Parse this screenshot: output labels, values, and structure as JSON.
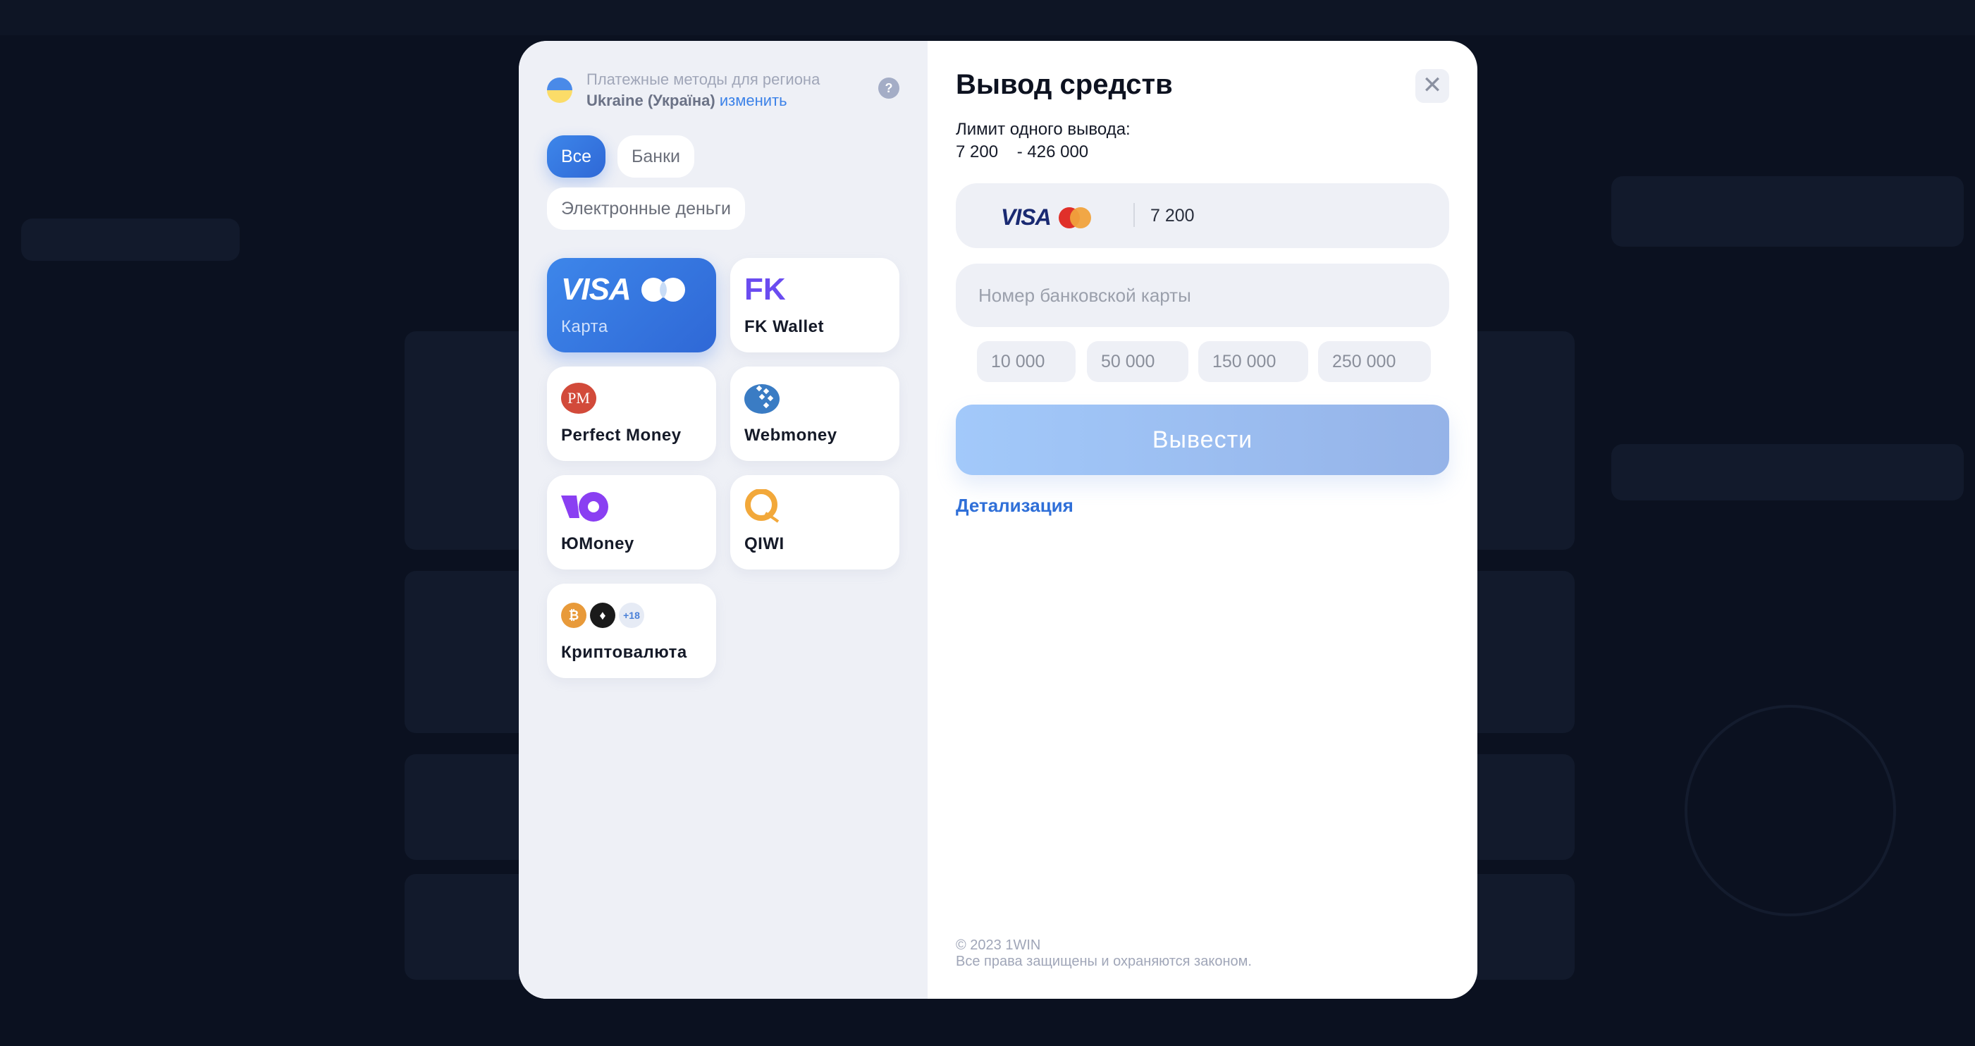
{
  "colors": {
    "accent": "#3578e5",
    "overlay": "#0b1120",
    "panel": "#eef0f6",
    "link": "#2f6fd8"
  },
  "region": {
    "label": "Платежные методы для региона",
    "country": "Ukraine (Україна)",
    "change_link": "изменить",
    "help_icon": "question-icon",
    "help_glyph": "?"
  },
  "filters": [
    {
      "label": "Все",
      "active": true
    },
    {
      "label": "Банки",
      "active": false
    },
    {
      "label": "Электронные деньги",
      "active": false
    }
  ],
  "methods": [
    {
      "label": "Карта",
      "icon": "visa-mastercard-icon",
      "active": true,
      "logo_text": "VISA"
    },
    {
      "label": "FK Wallet",
      "icon": "fk-wallet-icon",
      "logo_text": "FK"
    },
    {
      "label": "Perfect Money",
      "icon": "perfect-money-icon",
      "logo_text": "PM"
    },
    {
      "label": "Webmoney",
      "icon": "webmoney-icon"
    },
    {
      "label": "ЮMoney",
      "icon": "yoomoney-icon"
    },
    {
      "label": "QIWI",
      "icon": "qiwi-icon"
    },
    {
      "label": "Криптовалюта",
      "icon": "crypto-icon",
      "extra_count": "+18"
    }
  ],
  "withdraw": {
    "title": "Вывод средств",
    "close_glyph": "✕",
    "limit_label": "Лимит одного вывода:",
    "limit_range": "7 200    - 426 000",
    "amount_value": "7 200",
    "card_logo_text": "VISA",
    "card_number_placeholder": "Номер банковской карты",
    "quick_amounts": [
      "10 000",
      "50 000",
      "150 000",
      "250 000"
    ],
    "submit_label": "Вывести",
    "details_link": "Детализация"
  },
  "footer": {
    "copyright": "© 2023 1WIN",
    "rights": "Все права защищены и охраняются законом."
  }
}
